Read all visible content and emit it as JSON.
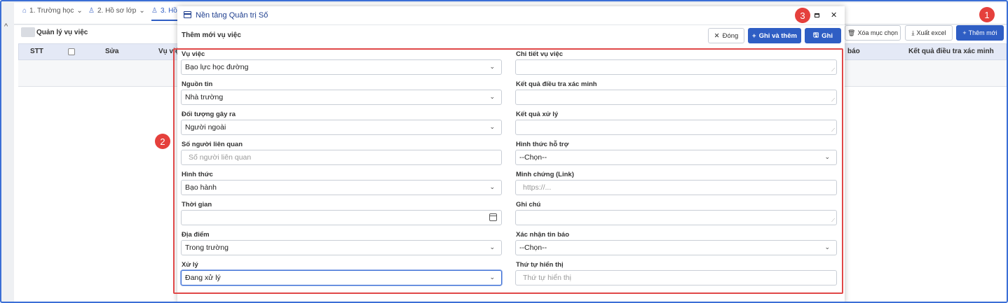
{
  "top_tabs": [
    {
      "icon": "school-icon",
      "label": "1. Trường học"
    },
    {
      "icon": "user-icon",
      "label": "2. Hồ sơ lớp"
    },
    {
      "icon": "users-icon",
      "label": "3. Hồ"
    }
  ],
  "background": {
    "page_title": "Quản lý vụ việc",
    "columns": {
      "stt": "STT",
      "edit": "Sửa",
      "case": "Vụ việ",
      "report": "báo",
      "result": "Kết quả điều tra xác minh"
    },
    "buttons": {
      "delete_selected": "Xóa mục chọn",
      "export_excel": "Xuất excel",
      "add_new": "Thêm mới"
    }
  },
  "modal": {
    "title": "Nền tảng Quản trị Số",
    "subtitle": "Thêm mới vụ việc",
    "buttons": {
      "close": "Đóng",
      "save_and_add": "Ghi và thêm",
      "save": "Ghi"
    },
    "left_fields": [
      {
        "label": "Vụ việc",
        "value": "Bạo lực học đường",
        "type": "select"
      },
      {
        "label": "Nguồn tin",
        "value": "Nhà trường",
        "type": "select"
      },
      {
        "label": "Đối tượng gây ra",
        "value": "Người ngoài",
        "type": "select"
      },
      {
        "label": "Số người liên quan",
        "placeholder": "Số người liên quan",
        "type": "input"
      },
      {
        "label": "Hình thức",
        "value": "Bạo hành",
        "type": "select"
      },
      {
        "label": "Thời gian",
        "value": "",
        "type": "date"
      },
      {
        "label": "Địa điểm",
        "value": "Trong trường",
        "type": "select"
      },
      {
        "label": "Xử lý",
        "value": "Đang xử lý",
        "type": "select"
      }
    ],
    "right_fields": [
      {
        "label": "Chi tiết vụ việc",
        "value": "",
        "type": "textarea"
      },
      {
        "label": "Kết quả điều tra xác minh",
        "value": "",
        "type": "textarea"
      },
      {
        "label": "Kết quả xử lý",
        "value": "",
        "type": "textarea"
      },
      {
        "label": "Hình thức hỗ trợ",
        "value": "--Chọn--",
        "type": "select"
      },
      {
        "label": "Minh chứng (Link)",
        "placeholder": "https://...",
        "type": "input"
      },
      {
        "label": "Ghi chú",
        "value": "",
        "type": "textarea"
      },
      {
        "label": "Xác nhận tin báo",
        "value": "--Chọn--",
        "type": "select"
      },
      {
        "label": "Thứ tự hiển thị",
        "placeholder": "Thứ tự hiển thị",
        "type": "input"
      }
    ]
  },
  "annotations": [
    "1",
    "2",
    "3"
  ],
  "colors": {
    "primary": "#2f5ec4",
    "annotation": "#e5403c",
    "border_frame": "#3b6fd6"
  }
}
